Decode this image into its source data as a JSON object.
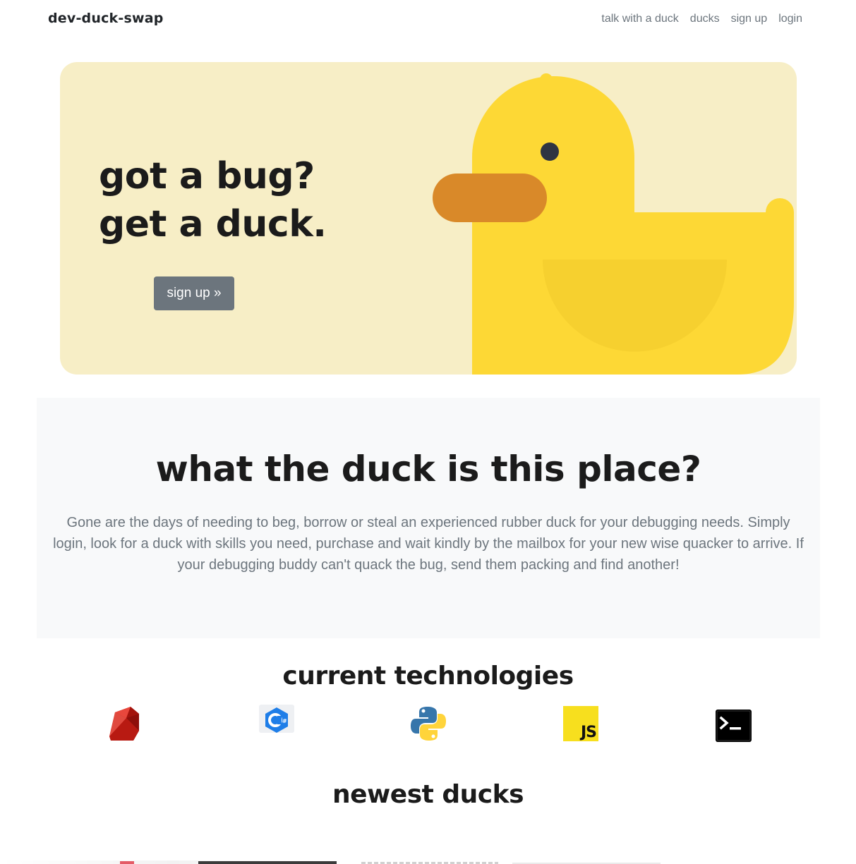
{
  "nav": {
    "brand": "dev-duck-swap",
    "links": [
      {
        "label": "talk with a duck"
      },
      {
        "label": "ducks"
      },
      {
        "label": "sign up"
      },
      {
        "label": "login"
      }
    ]
  },
  "hero": {
    "heading_line1": "got a bug?",
    "heading_line2": "get a duck.",
    "button_label": "sign up »",
    "background": "#f7eec6",
    "illustration": "rubber-duck"
  },
  "about": {
    "title": "what the duck is this place?",
    "text": "Gone are the days of needing to beg, borrow or steal an experienced rubber duck for your debugging needs. Simply login, look for a duck with skills you need, purchase and wait kindly by the mailbox for your new wise quacker to arrive. If your debugging buddy can't quack the bug, send them packing and find another!"
  },
  "technologies": {
    "title": "current technologies",
    "icons": [
      "ruby-icon",
      "csharp-icon",
      "python-icon",
      "javascript-icon",
      "terminal-icon"
    ],
    "js_label": "JS"
  },
  "newest": {
    "title": "newest ducks"
  },
  "colors": {
    "duck_yellow": "#fdd835",
    "duck_beak": "#d98929",
    "button_gray": "#6c757d",
    "muted_text": "#6c757d"
  }
}
